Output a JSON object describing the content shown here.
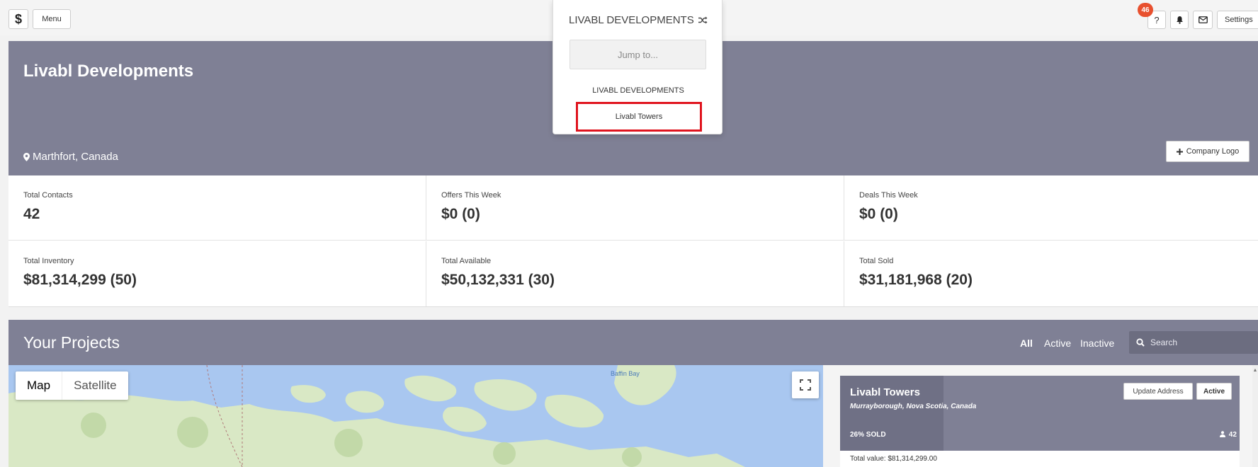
{
  "topbar": {
    "logo_glyph": "$",
    "menu_label": "Menu",
    "help_label": "?",
    "notification_count": "46",
    "settings_label": "Settings"
  },
  "company": {
    "name": "Livabl Developments",
    "location": "Marthfort, Canada",
    "logo_button_label": "Company Logo",
    "location_icon": "map-pin-icon",
    "logo_button_icon": "plus-icon"
  },
  "stats": [
    {
      "label": "Total Contacts",
      "value": "42"
    },
    {
      "label": "Offers This Week",
      "value": "$0 (0)"
    },
    {
      "label": "Deals This Week",
      "value": "$0 (0)"
    },
    {
      "label": "Total Inventory",
      "value": "$81,314,299 (50)"
    },
    {
      "label": "Total Available",
      "value": "$50,132,331 (30)"
    },
    {
      "label": "Total Sold",
      "value": "$31,181,968 (20)"
    }
  ],
  "projects": {
    "title": "Your Projects",
    "filters": {
      "all": "All",
      "active": "Active",
      "inactive": "Inactive"
    },
    "search_placeholder": "Search"
  },
  "map": {
    "type_map": "Map",
    "type_satellite": "Satellite",
    "label_baffin": "Baffin Bay"
  },
  "project_card": {
    "title": "Livabl Towers",
    "subtitle": "Murrayborough, Nova Scotia, Canada",
    "sold": "26% SOLD",
    "contacts": "42",
    "update_address_label": "Update Address",
    "status_label": "Active",
    "total_value": "Total value: $81,314,299.00"
  },
  "dropdown": {
    "title": "LIVABL DEVELOPMENTS",
    "jump_placeholder": "Jump to...",
    "section_label": "LIVABL DEVELOPMENTS",
    "item_label": "Livabl Towers"
  },
  "colors": {
    "header_bg": "#7f8095",
    "badge": "#e8502e",
    "highlight": "#e0141e",
    "map_water": "#a9c7f0",
    "map_land": "#d9e8c5"
  }
}
